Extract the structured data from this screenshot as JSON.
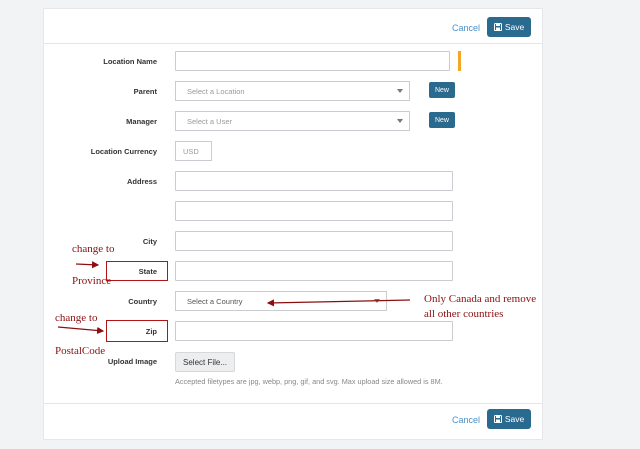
{
  "header": {
    "cancel_label": "Cancel",
    "save_label": "Save"
  },
  "footer": {
    "cancel_label": "Cancel",
    "save_label": "Save"
  },
  "form": {
    "location_name_label": "Location Name",
    "location_name_value": "",
    "parent_label": "Parent",
    "parent_placeholder": "Select a Location",
    "manager_label": "Manager",
    "manager_placeholder": "Select a User",
    "new_label": "New",
    "currency_label": "Location Currency",
    "currency_placeholder": "USD",
    "address_label": "Address",
    "city_label": "City",
    "state_label": "State",
    "country_label": "Country",
    "country_placeholder": "Select a Country",
    "zip_label": "Zip",
    "upload_label": "Upload Image",
    "select_file_label": "Select File...",
    "upload_help": "Accepted filetypes are jpg, webp, png, gif, and svg. Max upload size allowed is 8M."
  },
  "annotations": {
    "state_note_1": "change to",
    "state_note_2": "Province",
    "country_note_1": "Only Canada and remove",
    "country_note_2": "all other countries",
    "zip_note_1": "change to",
    "zip_note_2": "PostalCode"
  },
  "colors": {
    "primary": "#2a6a8e",
    "link": "#4a90c8",
    "annotation": "#8b0f0f",
    "required": "#f5a623"
  },
  "icons": {
    "save": "floppy-disk-icon",
    "caret": "chevron-down-icon"
  }
}
